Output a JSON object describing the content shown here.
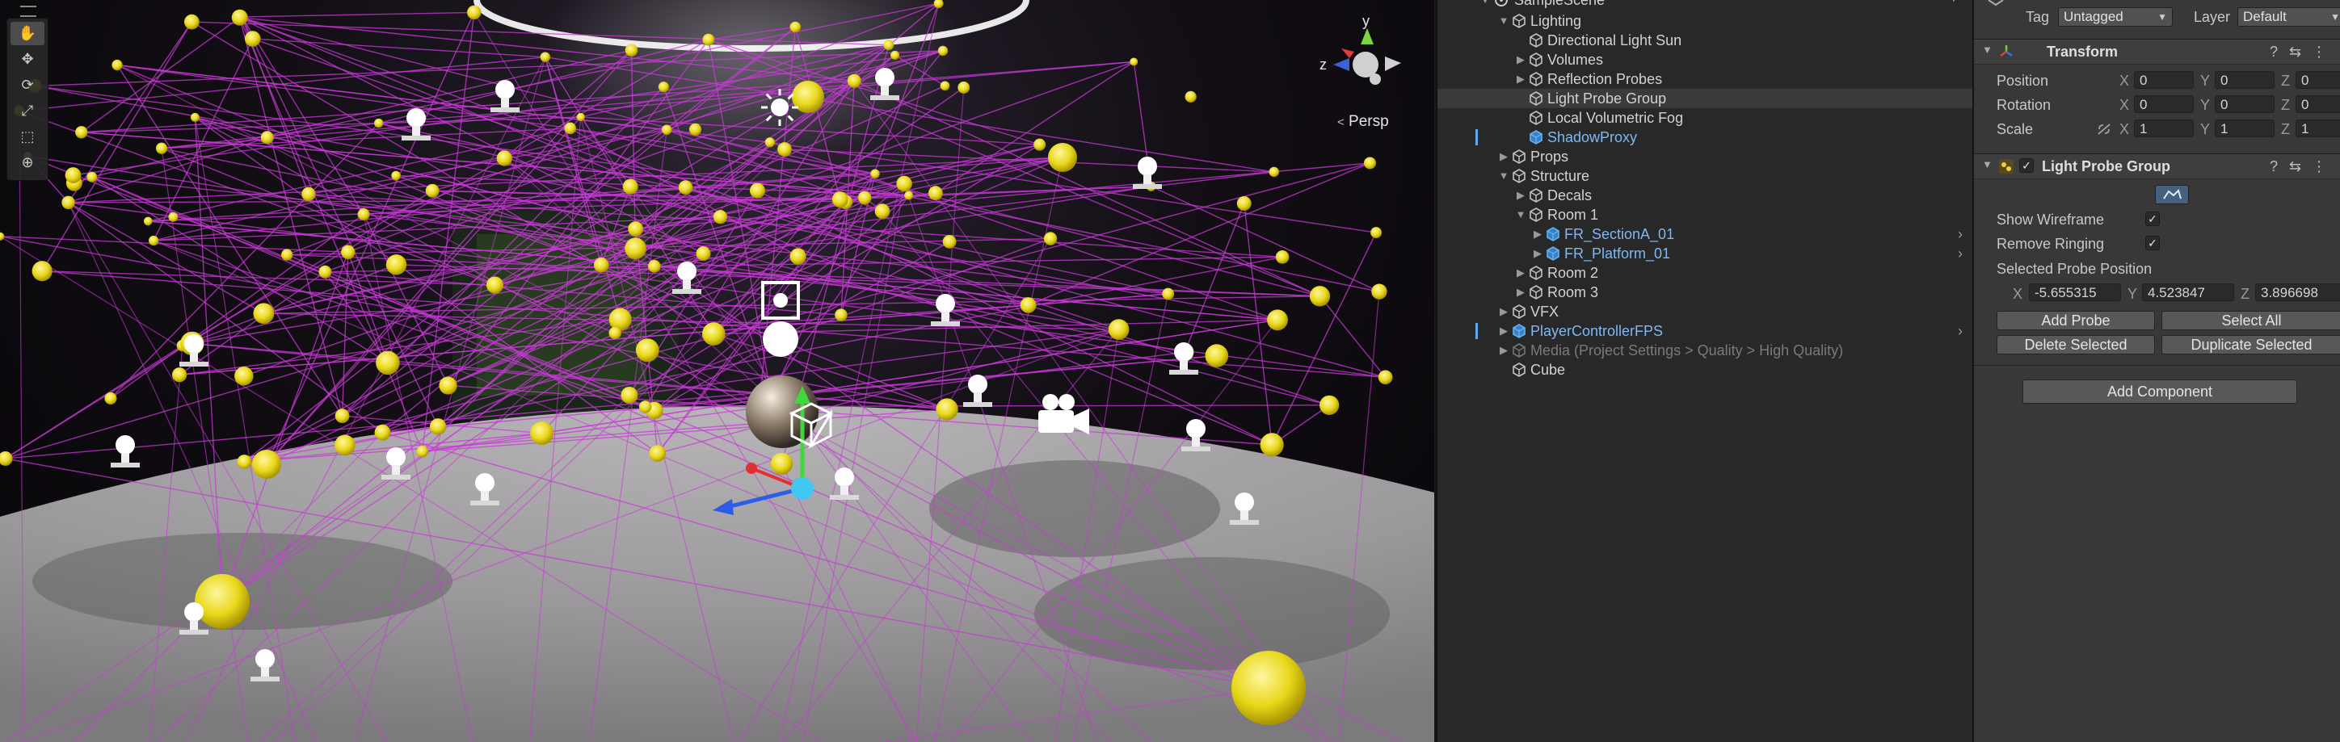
{
  "colors": {
    "probe_yellow": "#e8d81a",
    "wire_magenta": "#c93ad8",
    "prefab_blue": "#7fb8f2",
    "panel_bg": "#383838",
    "hierarchy_bg": "#282828"
  },
  "scene": {
    "tools": [
      {
        "name": "view-tool",
        "icon": "hand-icon",
        "glyph": "✋"
      },
      {
        "name": "move-tool",
        "icon": "move-icon",
        "glyph": "✥"
      },
      {
        "name": "rotate-tool",
        "icon": "rotate-icon",
        "glyph": "⟳"
      },
      {
        "name": "scale-tool",
        "icon": "scale-icon",
        "glyph": "⤢"
      },
      {
        "name": "rect-tool",
        "icon": "rect-icon",
        "glyph": "⬚"
      },
      {
        "name": "transform-tool",
        "icon": "transform-icon",
        "glyph": "⊕"
      }
    ],
    "gizmo": {
      "y": "y",
      "z": "z",
      "persp": "Persp"
    }
  },
  "hierarchy": {
    "scene_name": "SampleScene*",
    "items": [
      {
        "label": "Lighting",
        "depth": 1,
        "arrow": "open",
        "type": "object"
      },
      {
        "label": "Directional Light Sun",
        "depth": 2,
        "arrow": "none",
        "type": "object"
      },
      {
        "label": "Volumes",
        "depth": 2,
        "arrow": "closed",
        "type": "object"
      },
      {
        "label": "Reflection Probes",
        "depth": 2,
        "arrow": "closed",
        "type": "object"
      },
      {
        "label": "Light Probe Group",
        "depth": 2,
        "arrow": "none",
        "type": "object",
        "selected": true
      },
      {
        "label": "Local Volumetric Fog",
        "depth": 2,
        "arrow": "none",
        "type": "object"
      },
      {
        "label": "ShadowProxy",
        "depth": 2,
        "arrow": "none",
        "type": "prefab"
      },
      {
        "label": "Props",
        "depth": 1,
        "arrow": "closed",
        "type": "object"
      },
      {
        "label": "Structure",
        "depth": 1,
        "arrow": "open",
        "type": "object"
      },
      {
        "label": "Decals",
        "depth": 2,
        "arrow": "closed",
        "type": "object"
      },
      {
        "label": "Room 1",
        "depth": 2,
        "arrow": "open",
        "type": "object"
      },
      {
        "label": "FR_SectionA_01",
        "depth": 3,
        "arrow": "closed",
        "type": "prefab",
        "chevron": true
      },
      {
        "label": "FR_Platform_01",
        "depth": 3,
        "arrow": "closed",
        "type": "prefab",
        "chevron": true
      },
      {
        "label": "Room 2",
        "depth": 2,
        "arrow": "closed",
        "type": "object"
      },
      {
        "label": "Room 3",
        "depth": 2,
        "arrow": "closed",
        "type": "object"
      },
      {
        "label": "VFX",
        "depth": 1,
        "arrow": "closed",
        "type": "object"
      },
      {
        "label": "PlayerControllerFPS",
        "depth": 1,
        "arrow": "closed",
        "type": "prefab",
        "chevron": true
      },
      {
        "label": "Media (Project Settings > Quality > High Quality)",
        "depth": 1,
        "arrow": "closed",
        "type": "disabled"
      },
      {
        "label": "Cube",
        "depth": 1,
        "arrow": "none",
        "type": "object"
      }
    ]
  },
  "inspector": {
    "tag_label": "Tag",
    "tag_value": "Untagged",
    "layer_label": "Layer",
    "layer_value": "Default",
    "transform": {
      "title": "Transform",
      "position_label": "Position",
      "rotation_label": "Rotation",
      "scale_label": "Scale",
      "axis_x": "X",
      "axis_y": "Y",
      "axis_z": "Z",
      "position": [
        "0",
        "0",
        "0"
      ],
      "rotation": [
        "0",
        "0",
        "0"
      ],
      "scale": [
        "1",
        "1",
        "1"
      ]
    },
    "light_probe_group": {
      "title": "Light Probe Group",
      "show_wireframe_label": "Show Wireframe",
      "remove_ringing_label": "Remove Ringing",
      "selected_position_label": "Selected Probe Position",
      "probe_x": "-5.655315",
      "probe_y": "4.523847",
      "probe_z": "3.896698",
      "add_probe": "Add Probe",
      "select_all": "Select All",
      "delete_selected": "Delete Selected",
      "duplicate_selected": "Duplicate Selected"
    },
    "add_component": "Add Component",
    "check_glyph": "✓",
    "help_glyph": "?",
    "preset_glyph": "⇆",
    "menu_glyph": "⋮"
  }
}
